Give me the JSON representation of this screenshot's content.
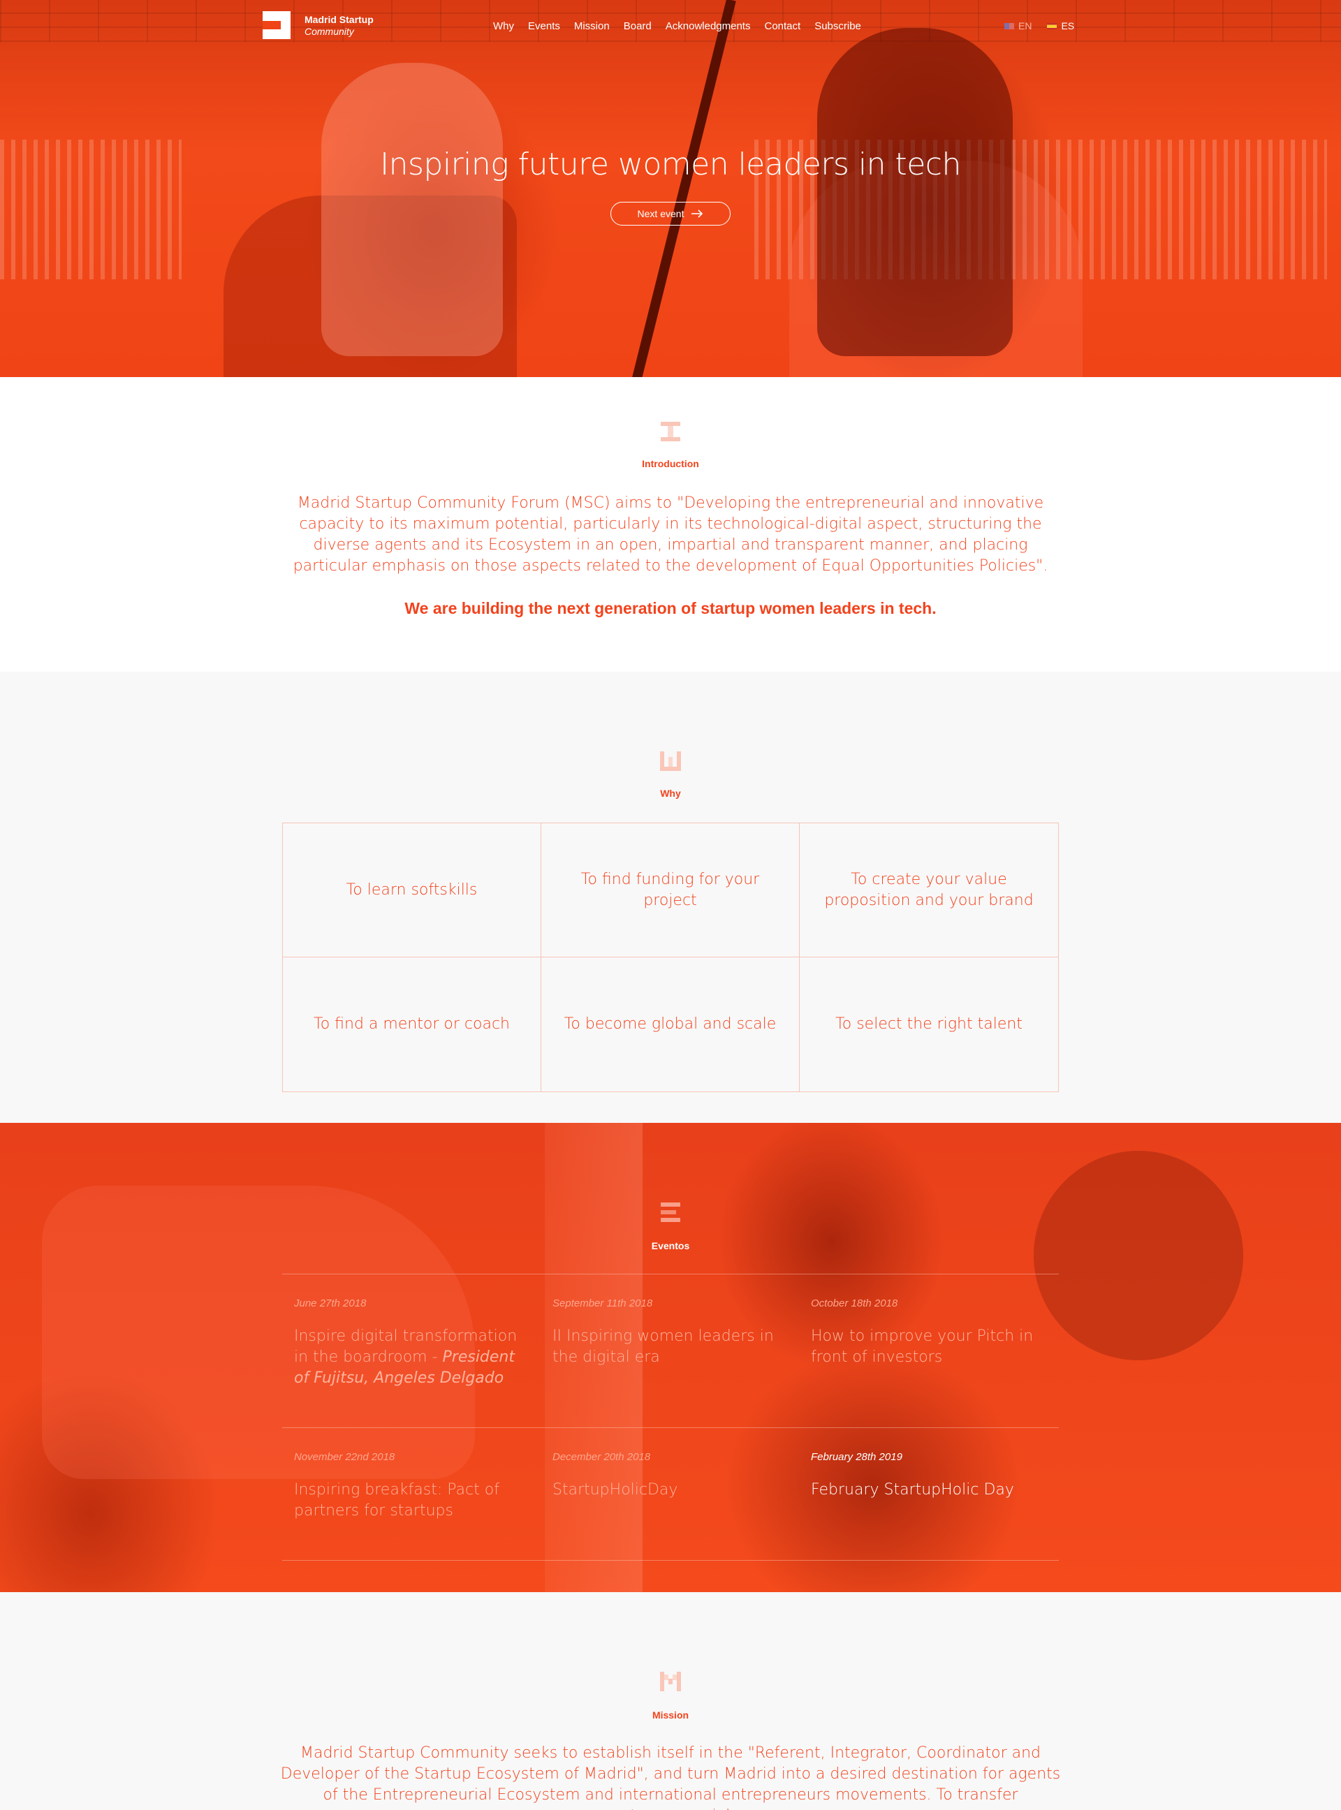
{
  "brand": {
    "line1": "Madrid Startup",
    "line2": "Community"
  },
  "nav": {
    "items": [
      "Why",
      "Events",
      "Mission",
      "Board",
      "Acknowledgments",
      "Contact",
      "Subscribe"
    ]
  },
  "languages": [
    {
      "code": "EN",
      "flag": "uk-flag-icon",
      "active": false
    },
    {
      "code": "ES",
      "flag": "spain-flag-icon",
      "active": true
    }
  ],
  "hero": {
    "title": "Inspiring future women leaders in tech",
    "button_label": "Next event",
    "button_icon": "arrow-right-icon"
  },
  "intro": {
    "label": "Introduction",
    "text": "Madrid Startup Community Forum (MSC) aims to \"Developing the entrepreneurial and innovative capacity to its maximum potential, particularly in its technological-digital aspect, structuring the diverse agents and its Ecosystem in an open, impartial and transparent manner, and placing particular emphasis on those aspects related to the development of Equal Opportunities Policies\".",
    "highlight": "We are building the next generation of startup women leaders in tech."
  },
  "why": {
    "label": "Why",
    "items": [
      "To learn softskills",
      "To find funding for your project",
      "To create your value proposition and your brand",
      "To find a mentor or coach",
      "To become global and scale",
      "To select the right talent"
    ]
  },
  "events": {
    "label": "Eventos",
    "items": [
      {
        "date": "June 27th 2018",
        "title": "Inspire digital transformation in the boardroom - ",
        "speaker": "President of Fujitsu, Angeles Delgado",
        "active": false
      },
      {
        "date": "September 11th 2018",
        "title": "II Inspiring women leaders in the digital era",
        "speaker": "",
        "active": false
      },
      {
        "date": "October 18th 2018",
        "title": "How to improve your Pitch in front of investors",
        "speaker": "",
        "active": false
      },
      {
        "date": "November 22nd 2018",
        "title": "Inspiring breakfast: Pact of partners for startups",
        "speaker": "",
        "active": false
      },
      {
        "date": "December 20th 2018",
        "title": "StartupHolicDay",
        "speaker": "",
        "active": false
      },
      {
        "date": "February 28th 2019",
        "title": "February StartupHolic Day",
        "speaker": "",
        "active": true
      }
    ]
  },
  "mission": {
    "label": "Mission",
    "text": "Madrid Startup Community seeks to establish itself in the \"Referent, Integrator, Coordinator and Developer of the Startup Ecosystem of Madrid\", and turn Madrid into a desired destination for agents of the Entrepreneurial Ecosystem and international entrepreneurs movements. To transfer entrepreneurial"
  },
  "colors": {
    "accent": "#f2431d",
    "hero_overlay": "#f04416",
    "section_gray": "#f8f8f8",
    "grid_border": "#f6c4b6"
  }
}
